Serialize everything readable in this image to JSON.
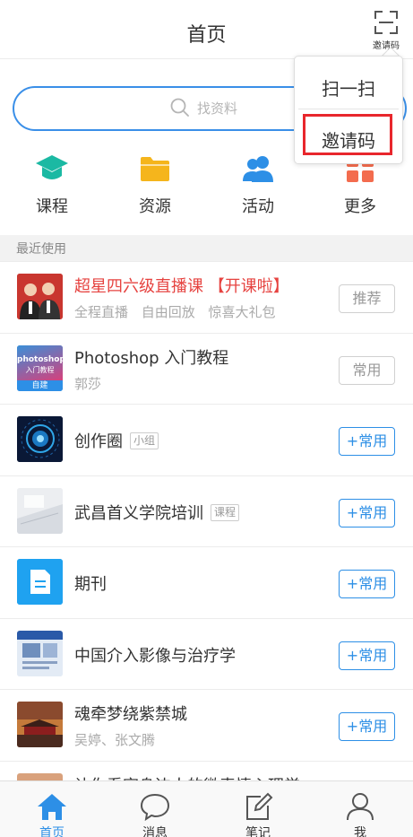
{
  "header": {
    "title": "首页",
    "scan_label": "邀请码"
  },
  "search": {
    "placeholder": "找资料"
  },
  "quick_entries": [
    {
      "label": "课程",
      "icon": "graduation-cap-icon",
      "color": "#1bb9a3"
    },
    {
      "label": "资源",
      "icon": "folder-icon",
      "color": "#f5b51c"
    },
    {
      "label": "活动",
      "icon": "people-icon",
      "color": "#2d8fe6"
    },
    {
      "label": "更多",
      "icon": "grid-icon",
      "color": "#f36c4e"
    }
  ],
  "section": {
    "title": "最近使用"
  },
  "list": [
    {
      "title": "超星四六级直播课",
      "title_suffix": "【开课啦】",
      "subtitle": "全程直播 自由回放 惊喜大礼包",
      "action": "推荐",
      "title_color": "#e64340"
    },
    {
      "title": "Photoshop 入门教程",
      "subtitle": "郭莎",
      "action": "常用",
      "thumb_text_1": "photoshop",
      "thumb_text_2": "入门教程",
      "thumb_badge": "自建"
    },
    {
      "title": "创作圈",
      "tag": "小组",
      "action": "+常用"
    },
    {
      "title": "武昌首义学院培训",
      "tag": "课程",
      "action": "+常用"
    },
    {
      "title": "期刊",
      "action": "+常用"
    },
    {
      "title": "中国介入影像与治疗学",
      "action": "+常用"
    },
    {
      "title": "魂牵梦绕紫禁城",
      "subtitle": "吴婷、张文腾",
      "action": "+常用"
    },
    {
      "title": "让你看穿身边人的微表情心理学"
    }
  ],
  "tabbar": [
    {
      "label": "首页",
      "icon": "home-icon",
      "active": true
    },
    {
      "label": "消息",
      "icon": "message-icon"
    },
    {
      "label": "笔记",
      "icon": "note-icon"
    },
    {
      "label": "我",
      "icon": "profile-icon"
    }
  ],
  "popup": {
    "items": [
      "扫一扫",
      "邀请码"
    ],
    "highlight_color": "#e8262c"
  },
  "colors": {
    "accent": "#2d8fe6",
    "search_border": "#3a8fe8"
  }
}
